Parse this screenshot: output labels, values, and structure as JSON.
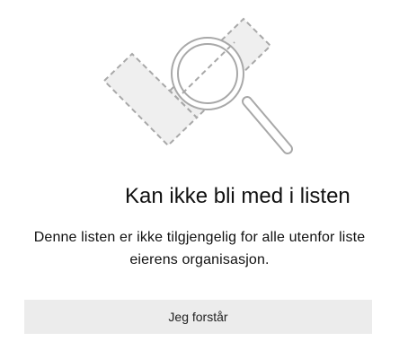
{
  "dialog": {
    "illustration_icon": "dashed-list-with-magnifier-icon",
    "title": "Kan ikke bli med i listen",
    "message": "Denne listen er ikke tilgjengelig for alle utenfor liste eierens organisasjon.",
    "ok_button_label": "Jeg forstår"
  },
  "colors": {
    "background": "#ffffff",
    "button_background": "#ececec",
    "illustration_fill": "#efefef",
    "illustration_stroke": "#a8a8a8"
  }
}
